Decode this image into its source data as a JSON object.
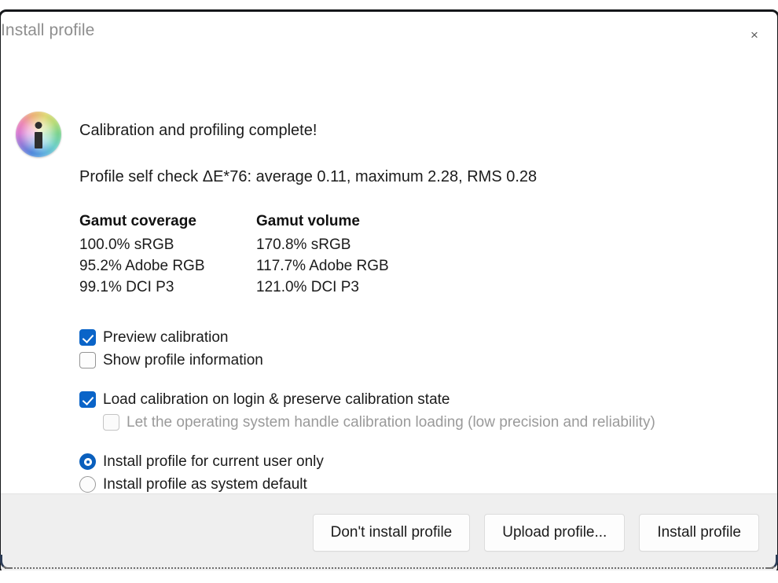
{
  "window": {
    "title": "Install profile",
    "close_icon": "close-icon",
    "close_glyph": "×"
  },
  "content": {
    "icon": "color-wheel-info-icon",
    "headline": "Calibration and profiling complete!",
    "self_check": "Profile self check ΔE*76: average 0.11, maximum 2.28, RMS 0.28",
    "gamut": {
      "columns": [
        {
          "header": "Gamut coverage",
          "rows": [
            "100.0% sRGB",
            "95.2% Adobe RGB",
            "99.1% DCI P3"
          ]
        },
        {
          "header": "Gamut volume",
          "rows": [
            "170.8% sRGB",
            "117.7% Adobe RGB",
            "121.0% DCI P3"
          ]
        }
      ]
    },
    "options": {
      "preview_calibration": {
        "label": "Preview calibration",
        "checked": true,
        "disabled": false
      },
      "show_profile_information": {
        "label": "Show profile information",
        "checked": false,
        "disabled": false
      },
      "load_calibration_on_login": {
        "label": "Load calibration on login & preserve calibration state",
        "checked": true,
        "disabled": false
      },
      "os_handle_calibration": {
        "label": "Let the operating system handle calibration loading (low precision and reliability)",
        "checked": false,
        "disabled": true
      },
      "install_current_user": {
        "label": "Install profile for current user only",
        "selected": true
      },
      "install_system_default": {
        "label": "Install profile as system default",
        "selected": false
      }
    }
  },
  "footer": {
    "dont_install_label": "Don't install profile",
    "upload_label": "Upload profile...",
    "install_label": "Install profile"
  },
  "colors": {
    "accent": "#0a64c8",
    "radio_accent": "#0a5fbd",
    "title_text": "#8e8e8e",
    "body_text": "#1b1b1b",
    "disabled_text": "#9a9a9a",
    "footer_bg": "#efefef",
    "button_bg": "#fdfdfd",
    "button_border": "#dcdcdc",
    "frame": "#15171a"
  }
}
